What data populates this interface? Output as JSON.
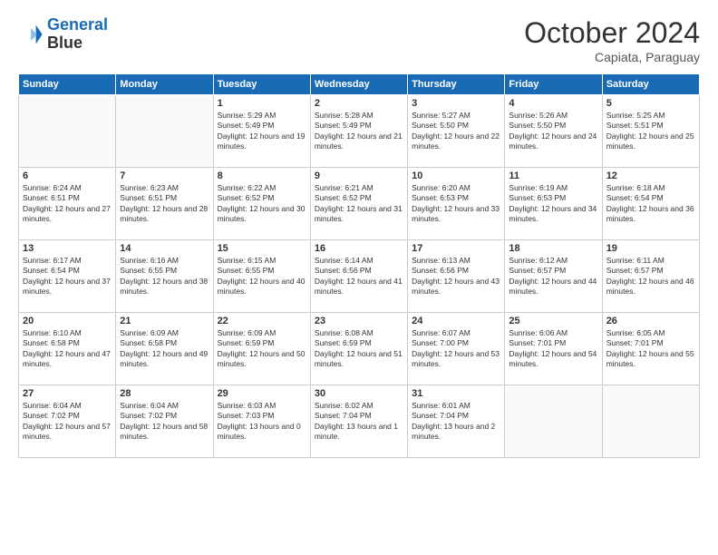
{
  "logo": {
    "line1": "General",
    "line2": "Blue"
  },
  "title": "October 2024",
  "subtitle": "Capiata, Paraguay",
  "days": [
    "Sunday",
    "Monday",
    "Tuesday",
    "Wednesday",
    "Thursday",
    "Friday",
    "Saturday"
  ],
  "weeks": [
    [
      {
        "day": "",
        "info": ""
      },
      {
        "day": "",
        "info": ""
      },
      {
        "day": "1",
        "info": "Sunrise: 5:29 AM\nSunset: 5:49 PM\nDaylight: 12 hours and 19 minutes."
      },
      {
        "day": "2",
        "info": "Sunrise: 5:28 AM\nSunset: 5:49 PM\nDaylight: 12 hours and 21 minutes."
      },
      {
        "day": "3",
        "info": "Sunrise: 5:27 AM\nSunset: 5:50 PM\nDaylight: 12 hours and 22 minutes."
      },
      {
        "day": "4",
        "info": "Sunrise: 5:26 AM\nSunset: 5:50 PM\nDaylight: 12 hours and 24 minutes."
      },
      {
        "day": "5",
        "info": "Sunrise: 5:25 AM\nSunset: 5:51 PM\nDaylight: 12 hours and 25 minutes."
      }
    ],
    [
      {
        "day": "6",
        "info": "Sunrise: 6:24 AM\nSunset: 6:51 PM\nDaylight: 12 hours and 27 minutes."
      },
      {
        "day": "7",
        "info": "Sunrise: 6:23 AM\nSunset: 6:51 PM\nDaylight: 12 hours and 28 minutes."
      },
      {
        "day": "8",
        "info": "Sunrise: 6:22 AM\nSunset: 6:52 PM\nDaylight: 12 hours and 30 minutes."
      },
      {
        "day": "9",
        "info": "Sunrise: 6:21 AM\nSunset: 6:52 PM\nDaylight: 12 hours and 31 minutes."
      },
      {
        "day": "10",
        "info": "Sunrise: 6:20 AM\nSunset: 6:53 PM\nDaylight: 12 hours and 33 minutes."
      },
      {
        "day": "11",
        "info": "Sunrise: 6:19 AM\nSunset: 6:53 PM\nDaylight: 12 hours and 34 minutes."
      },
      {
        "day": "12",
        "info": "Sunrise: 6:18 AM\nSunset: 6:54 PM\nDaylight: 12 hours and 36 minutes."
      }
    ],
    [
      {
        "day": "13",
        "info": "Sunrise: 6:17 AM\nSunset: 6:54 PM\nDaylight: 12 hours and 37 minutes."
      },
      {
        "day": "14",
        "info": "Sunrise: 6:16 AM\nSunset: 6:55 PM\nDaylight: 12 hours and 38 minutes."
      },
      {
        "day": "15",
        "info": "Sunrise: 6:15 AM\nSunset: 6:55 PM\nDaylight: 12 hours and 40 minutes."
      },
      {
        "day": "16",
        "info": "Sunrise: 6:14 AM\nSunset: 6:56 PM\nDaylight: 12 hours and 41 minutes."
      },
      {
        "day": "17",
        "info": "Sunrise: 6:13 AM\nSunset: 6:56 PM\nDaylight: 12 hours and 43 minutes."
      },
      {
        "day": "18",
        "info": "Sunrise: 6:12 AM\nSunset: 6:57 PM\nDaylight: 12 hours and 44 minutes."
      },
      {
        "day": "19",
        "info": "Sunrise: 6:11 AM\nSunset: 6:57 PM\nDaylight: 12 hours and 46 minutes."
      }
    ],
    [
      {
        "day": "20",
        "info": "Sunrise: 6:10 AM\nSunset: 6:58 PM\nDaylight: 12 hours and 47 minutes."
      },
      {
        "day": "21",
        "info": "Sunrise: 6:09 AM\nSunset: 6:58 PM\nDaylight: 12 hours and 49 minutes."
      },
      {
        "day": "22",
        "info": "Sunrise: 6:09 AM\nSunset: 6:59 PM\nDaylight: 12 hours and 50 minutes."
      },
      {
        "day": "23",
        "info": "Sunrise: 6:08 AM\nSunset: 6:59 PM\nDaylight: 12 hours and 51 minutes."
      },
      {
        "day": "24",
        "info": "Sunrise: 6:07 AM\nSunset: 7:00 PM\nDaylight: 12 hours and 53 minutes."
      },
      {
        "day": "25",
        "info": "Sunrise: 6:06 AM\nSunset: 7:01 PM\nDaylight: 12 hours and 54 minutes."
      },
      {
        "day": "26",
        "info": "Sunrise: 6:05 AM\nSunset: 7:01 PM\nDaylight: 12 hours and 55 minutes."
      }
    ],
    [
      {
        "day": "27",
        "info": "Sunrise: 6:04 AM\nSunset: 7:02 PM\nDaylight: 12 hours and 57 minutes."
      },
      {
        "day": "28",
        "info": "Sunrise: 6:04 AM\nSunset: 7:02 PM\nDaylight: 12 hours and 58 minutes."
      },
      {
        "day": "29",
        "info": "Sunrise: 6:03 AM\nSunset: 7:03 PM\nDaylight: 13 hours and 0 minutes."
      },
      {
        "day": "30",
        "info": "Sunrise: 6:02 AM\nSunset: 7:04 PM\nDaylight: 13 hours and 1 minute."
      },
      {
        "day": "31",
        "info": "Sunrise: 6:01 AM\nSunset: 7:04 PM\nDaylight: 13 hours and 2 minutes."
      },
      {
        "day": "",
        "info": ""
      },
      {
        "day": "",
        "info": ""
      }
    ]
  ]
}
